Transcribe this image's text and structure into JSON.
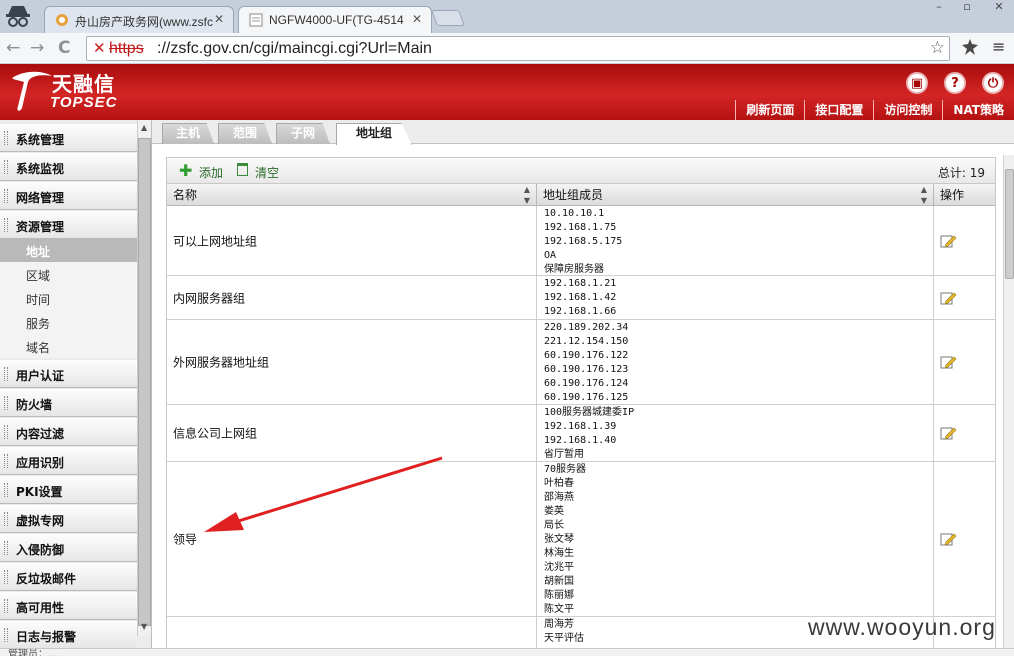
{
  "browser": {
    "tabs": [
      {
        "title": "舟山房产政务网(www.zsfc",
        "close": "✕"
      },
      {
        "title": "NGFW4000-UF(TG-4514",
        "close": "✕"
      }
    ],
    "window_controls": [
      "–",
      "▫",
      "✕"
    ],
    "nav": {
      "back": "←",
      "forward": "→",
      "reload": "C"
    },
    "address": {
      "insecure_mark": "✕",
      "scheme": "https",
      "rest": "://zsfc.gov.cn/cgi/maincgi.cgi?Url=Main"
    },
    "star": "☆",
    "menu": "≡"
  },
  "header": {
    "logo_cn": "天融信",
    "logo_en": "TOPSEC",
    "icons": [
      "save-icon",
      "help-icon",
      "logout-icon"
    ],
    "links": [
      "刷新页面",
      "接口配置",
      "访问控制",
      "NAT策略"
    ]
  },
  "sidebar": {
    "groups": [
      {
        "label": "系统管理"
      },
      {
        "label": "系统监视"
      },
      {
        "label": "网络管理"
      },
      {
        "label": "资源管理",
        "children": [
          {
            "label": "地址",
            "active": true
          },
          {
            "label": "区域"
          },
          {
            "label": "时间"
          },
          {
            "label": "服务"
          },
          {
            "label": "域名"
          }
        ]
      },
      {
        "label": "用户认证"
      },
      {
        "label": "防火墙"
      },
      {
        "label": "内容过滤"
      },
      {
        "label": "应用识别"
      },
      {
        "label": "PKI设置"
      },
      {
        "label": "虚拟专网"
      },
      {
        "label": "入侵防御"
      },
      {
        "label": "反垃圾邮件"
      },
      {
        "label": "高可用性"
      },
      {
        "label": "日志与报警"
      }
    ]
  },
  "content_tabs": [
    {
      "label": "主机"
    },
    {
      "label": "范围"
    },
    {
      "label": "子网"
    },
    {
      "label": "地址组",
      "active": true
    }
  ],
  "toolbar": {
    "add_label": "添加",
    "clear_label": "清空",
    "total_label": "总计:",
    "total_value": "19"
  },
  "table": {
    "columns": [
      "名称",
      "地址组成员",
      "操作"
    ],
    "rows": [
      {
        "name": "可以上网地址组",
        "members": [
          "10.10.10.1",
          "192.168.1.75",
          "192.168.5.175",
          "OA",
          "保障房服务器"
        ]
      },
      {
        "name": "内网服务器组",
        "members": [
          "192.168.1.21",
          "192.168.1.42",
          "192.168.1.66"
        ]
      },
      {
        "name": "外网服务器地址组",
        "members": [
          "220.189.202.34",
          "221.12.154.150",
          "60.190.176.122",
          "60.190.176.123",
          "60.190.176.124",
          "60.190.176.125"
        ]
      },
      {
        "name": "信息公司上网组",
        "members": [
          "100服务器城建委IP",
          "192.168.1.39",
          "192.168.1.40",
          "省厅暂用"
        ]
      },
      {
        "name": "领导",
        "members": [
          "70服务器",
          "叶柏春",
          "邵海燕",
          "娄英",
          "局长",
          "张文琴",
          "林海生",
          "沈兆平",
          "胡新国",
          "陈丽娜",
          "陈文平"
        ]
      },
      {
        "name": "",
        "members": [
          "周海芳",
          "天平评估"
        ]
      }
    ]
  },
  "accent_colors": {
    "header_red": "#c81a1a",
    "annotation_red": "#e02020",
    "add_green": "#2e9e2e"
  },
  "watermark": "www.wooyun.org",
  "status_text": "管理员：..."
}
